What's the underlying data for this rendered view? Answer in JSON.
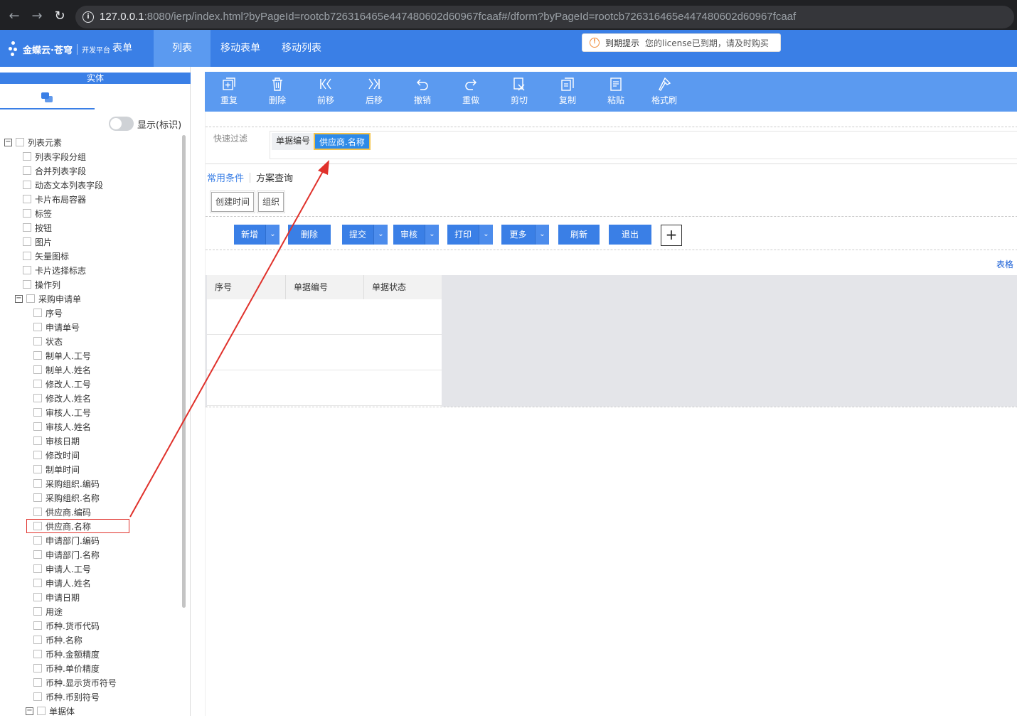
{
  "browser": {
    "url_host": "127.0.0.1",
    "url_rest": ":8080/ierp/index.html?byPageId=rootcb726316465e447480602d60967fcaaf#/dform?byPageId=rootcb726316465e447480602d60967fcaaf"
  },
  "header": {
    "logo_name": "金蝶云·苍穹",
    "logo_sub": "开发平台",
    "tabs": [
      "表单",
      "列表",
      "移动表单",
      "移动列表"
    ],
    "active_tab": "列表",
    "notice_title": "到期提示",
    "notice_text": "您的license已到期，请及时购买"
  },
  "left": {
    "entity_title": "实体",
    "toggle_label": "显示(标识)",
    "tree": [
      {
        "label": "列表元素",
        "level": 0,
        "expander": "−"
      },
      {
        "label": "列表字段分组",
        "level": 1
      },
      {
        "label": "合并列表字段",
        "level": 1
      },
      {
        "label": "动态文本列表字段",
        "level": 1
      },
      {
        "label": "卡片布局容器",
        "level": 1
      },
      {
        "label": "标签",
        "level": 1
      },
      {
        "label": "按钮",
        "level": 1
      },
      {
        "label": "图片",
        "level": 1
      },
      {
        "label": "矢量图标",
        "level": 1
      },
      {
        "label": "卡片选择标志",
        "level": 1
      },
      {
        "label": "操作列",
        "level": 1
      },
      {
        "label": "采购申请单",
        "level": 1,
        "expander": "−"
      },
      {
        "label": "序号",
        "level": 2
      },
      {
        "label": "申请单号",
        "level": 2
      },
      {
        "label": "状态",
        "level": 2
      },
      {
        "label": "制单人.工号",
        "level": 2
      },
      {
        "label": "制单人.姓名",
        "level": 2
      },
      {
        "label": "修改人.工号",
        "level": 2
      },
      {
        "label": "修改人.姓名",
        "level": 2
      },
      {
        "label": "审核人.工号",
        "level": 2
      },
      {
        "label": "审核人.姓名",
        "level": 2
      },
      {
        "label": "审核日期",
        "level": 2
      },
      {
        "label": "修改时间",
        "level": 2
      },
      {
        "label": "制单时间",
        "level": 2
      },
      {
        "label": "采购组织.编码",
        "level": 2
      },
      {
        "label": "采购组织.名称",
        "level": 2
      },
      {
        "label": "供应商.编码",
        "level": 2
      },
      {
        "label": "供应商.名称",
        "level": 2
      },
      {
        "label": "申请部门.编码",
        "level": 2
      },
      {
        "label": "申请部门.名称",
        "level": 2
      },
      {
        "label": "申请人.工号",
        "level": 2
      },
      {
        "label": "申请人.姓名",
        "level": 2
      },
      {
        "label": "申请日期",
        "level": 2
      },
      {
        "label": "用途",
        "level": 2
      },
      {
        "label": "币种.货币代码",
        "level": 2
      },
      {
        "label": "币种.名称",
        "level": 2
      },
      {
        "label": "币种.金额精度",
        "level": 2
      },
      {
        "label": "币种.单价精度",
        "level": 2
      },
      {
        "label": "币种.显示货币符号",
        "level": 2
      },
      {
        "label": "币种.币别符号",
        "level": 2
      },
      {
        "label": "单据体",
        "level": 2,
        "expander": "−"
      }
    ]
  },
  "toolbar": {
    "items": [
      {
        "label": "重复",
        "icon": "duplicate-icon"
      },
      {
        "label": "删除",
        "icon": "trash-icon"
      },
      {
        "label": "前移",
        "icon": "move-forward-icon"
      },
      {
        "label": "后移",
        "icon": "move-back-icon"
      },
      {
        "label": "撤销",
        "icon": "undo-icon"
      },
      {
        "label": "重做",
        "icon": "redo-icon"
      },
      {
        "label": "剪切",
        "icon": "cut-icon"
      },
      {
        "label": "复制",
        "icon": "copy-icon"
      },
      {
        "label": "粘贴",
        "icon": "paste-icon"
      },
      {
        "label": "格式刷",
        "icon": "format-brush-icon"
      }
    ]
  },
  "design": {
    "quick_filter_label": "快速过滤",
    "quick_filter_fields": [
      "单据编号",
      "供应商.名称"
    ],
    "cond_tabs": [
      "常用条件",
      "方案查询"
    ],
    "chips": [
      "创建时间",
      "组织"
    ],
    "buttons": [
      {
        "label": "新增",
        "dropdown": true
      },
      {
        "label": "删除",
        "dropdown": false
      },
      {
        "label": "提交",
        "dropdown": true
      },
      {
        "label": "审核",
        "dropdown": true
      },
      {
        "label": "打印",
        "dropdown": true
      },
      {
        "label": "更多",
        "dropdown": true
      },
      {
        "label": "刷新",
        "dropdown": false
      },
      {
        "label": "退出",
        "dropdown": false
      }
    ],
    "plus": "+",
    "table_link": "表格",
    "columns": [
      "序号",
      "单据编号",
      "单据状态"
    ]
  },
  "colors": {
    "brand": "#3a7fe6",
    "toolbar": "#5b9af0",
    "annotation": "#e0312b",
    "selected_field": "#2d8ae8"
  }
}
